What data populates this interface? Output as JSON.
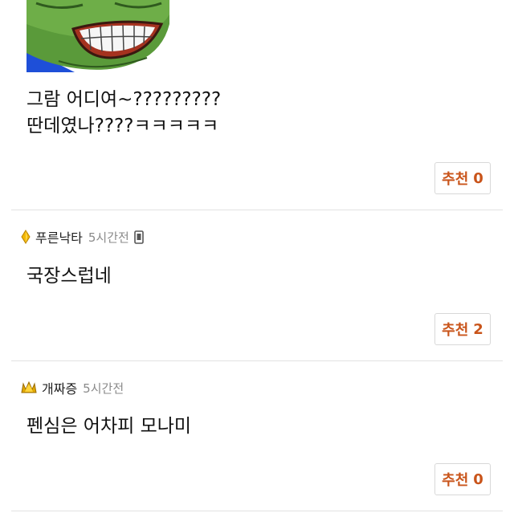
{
  "top_comment": {
    "image_icon": "smiling-frog-meme",
    "lines": [
      "그람 어디여~?????????",
      "딴데였나????ㅋㅋㅋㅋㅋ"
    ],
    "recommend": {
      "label": "추천",
      "count": "0"
    }
  },
  "comments": [
    {
      "rank_icon": "yellow-diamond-icon",
      "username": "푸른낙타",
      "time": "5시간전",
      "device_icon": "mobile-phone-icon",
      "text": "국장스럽네",
      "recommend": {
        "label": "추천",
        "count": "2"
      }
    },
    {
      "rank_icon": "gold-crown-icon",
      "username": "개짜증",
      "time": "5시간전",
      "text": "펜심은 어차피 모나미",
      "recommend": {
        "label": "추천",
        "count": "0"
      }
    }
  ],
  "colors": {
    "accent": "#c9541a",
    "divider": "#e2e2e2",
    "meta_text": "#8a8a8a"
  }
}
